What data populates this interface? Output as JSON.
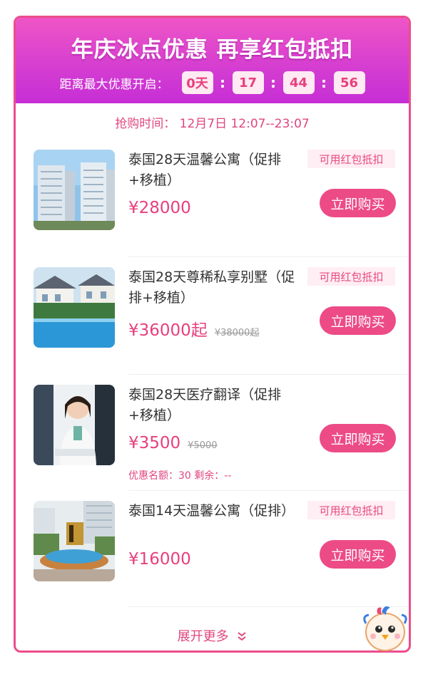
{
  "header": {
    "headline": "年庆冰点优惠  再享红包抵扣",
    "countdown_label": "距离最大优惠开启：",
    "days": "0天",
    "hours": "17",
    "minutes": "44",
    "seconds": "56",
    "separator": ":"
  },
  "purchase_time": "抢购时间：  12月7日 12:07--23:07",
  "products": [
    {
      "title": "泰国28天温馨公寓（促排+移植）",
      "tag": "可用红包抵扣",
      "price": "¥28000",
      "old_price": "",
      "buy_label": "立即购买",
      "image": "apartment-towers-photo"
    },
    {
      "title": "泰国28天尊稀私享别墅（促排+移植）",
      "tag": "可用红包抵扣",
      "price": "¥36000起",
      "old_price": "¥38000起",
      "buy_label": "立即购买",
      "image": "villa-pool-photo"
    },
    {
      "title": "泰国28天医疗翻译（促排+移植）",
      "tag": "",
      "price": "¥3500",
      "old_price": "¥5000",
      "buy_label": "立即购买",
      "quota": "优惠名额：30    剩余：--",
      "image": "translator-meeting-photo"
    },
    {
      "title": "泰国14天温馨公寓（促排）",
      "tag": "可用红包抵扣",
      "price": "¥16000",
      "old_price": "",
      "buy_label": "立即购买",
      "image": "apartment-fountain-photo"
    }
  ],
  "show_more": "展开更多",
  "colors": {
    "accent": "#ec4b86",
    "header_gradient_top": "#ef55c6",
    "header_gradient_bottom": "#c62ed6",
    "tag_bg": "#ffeef3"
  },
  "icons": {
    "expand": "double-chevron-down-icon",
    "mascot": "bird-mascot-icon"
  }
}
